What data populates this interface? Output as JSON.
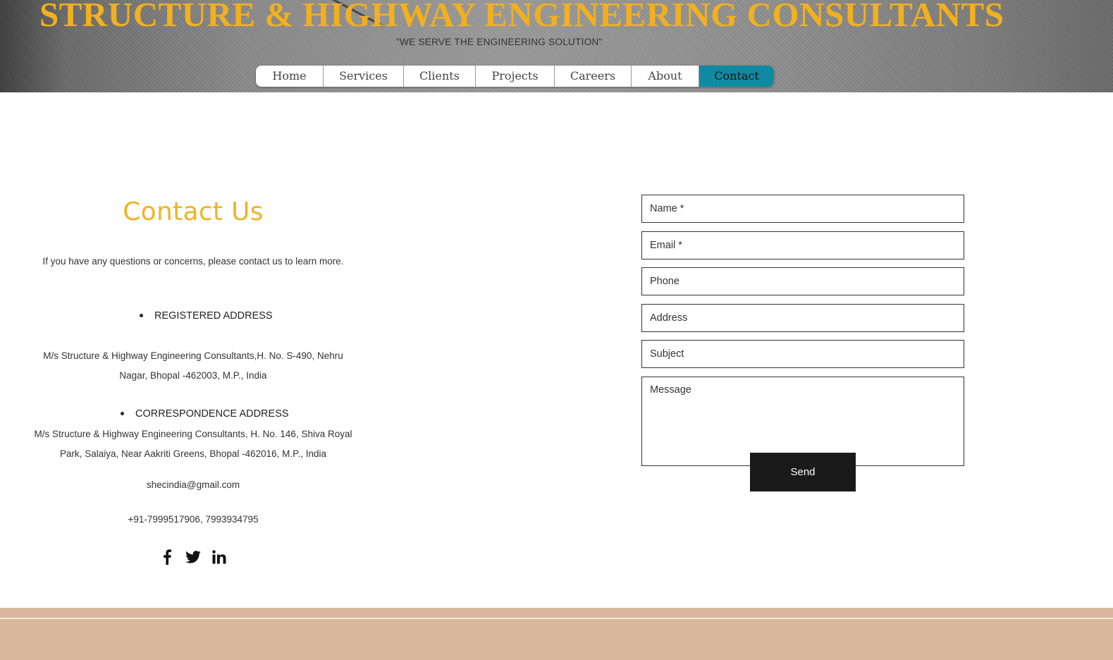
{
  "header": {
    "title": "STRUCTURE & HIGHWAY ENGINEERING CONSULTANTS",
    "tagline": "\"WE SERVE THE ENGINEERING SOLUTION\""
  },
  "nav": {
    "items": [
      {
        "label": "Home"
      },
      {
        "label": "Services"
      },
      {
        "label": "Clients"
      },
      {
        "label": "Projects"
      },
      {
        "label": "Careers"
      },
      {
        "label": "About"
      },
      {
        "label": "Contact"
      }
    ],
    "active": "Contact"
  },
  "contact": {
    "title": "Contact Us",
    "intro": "If you have any questions or concerns, please contact us to learn more.",
    "registered_heading": "REGISTERED ADDRESS",
    "registered_address": "M/s Structure & Highway Engineering Consultants,H. No. S-490, Nehru Nagar, Bhopal -462003, M.P., India",
    "correspondence_heading": "CORRESPONDENCE ADDRESS",
    "correspondence_address": "M/s Structure & Highway Engineering Consultants, H. No. 146, Shiva Royal Park, Salaiya, Near Aakriti Greens, Bhopal  -462016, M.P., India",
    "email": "shecindia@gmail.com",
    "phone": "+91-7999517906, 7993934795",
    "social": [
      "facebook-icon",
      "twitter-icon",
      "linkedin-icon"
    ]
  },
  "form": {
    "name_placeholder": "Name *",
    "email_placeholder": "Email *",
    "phone_placeholder": "Phone",
    "address_placeholder": "Address",
    "subject_placeholder": "Subject",
    "message_placeholder": "Message",
    "send_label": "Send"
  },
  "colors": {
    "title_gold": "#f2b01e",
    "nav_active": "#0f8aa3",
    "footer": "#dab79a",
    "button": "#1a1a1a"
  }
}
